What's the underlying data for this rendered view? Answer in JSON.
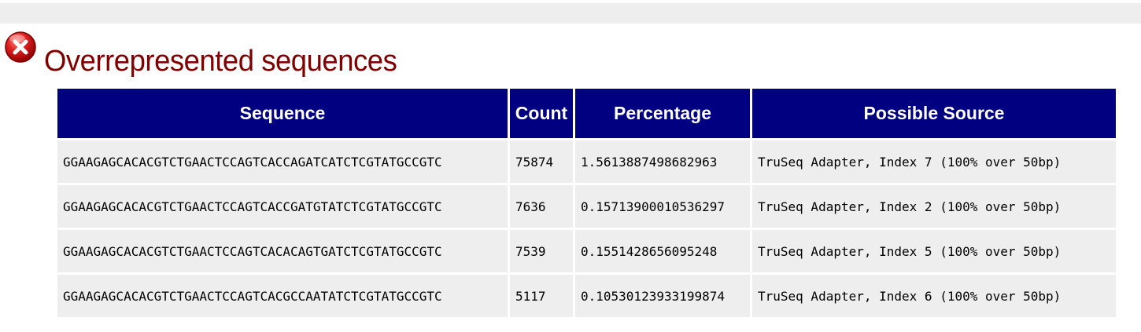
{
  "header": {
    "title": "Overrepresented sequences",
    "status_icon": "fail-icon",
    "status_color": "#cc0000"
  },
  "colors": {
    "title_text": "#800000",
    "header_background": "#000080",
    "header_text": "#ffffff",
    "cell_background": "#eeeeee"
  },
  "table": {
    "columns": [
      "Sequence",
      "Count",
      "Percentage",
      "Possible Source"
    ],
    "rows": [
      [
        "GGAAGAGCACACGTCTGAACTCCAGTCACCAGATCATCTCGTATGCCGTC",
        "75874",
        "1.5613887498682963",
        "TruSeq Adapter, Index 7 (100% over 50bp)"
      ],
      [
        "GGAAGAGCACACGTCTGAACTCCAGTCACCGATGTATCTCGTATGCCGTC",
        "7636",
        "0.15713900010536297",
        "TruSeq Adapter, Index 2 (100% over 50bp)"
      ],
      [
        "GGAAGAGCACACGTCTGAACTCCAGTCACACAGTGATCTCGTATGCCGTC",
        "7539",
        "0.1551428656095248",
        "TruSeq Adapter, Index 5 (100% over 50bp)"
      ],
      [
        "GGAAGAGCACACGTCTGAACTCCAGTCACGCCAATATCTCGTATGCCGTC",
        "5117",
        "0.10530123933199874",
        "TruSeq Adapter, Index 6 (100% over 50bp)"
      ]
    ]
  }
}
